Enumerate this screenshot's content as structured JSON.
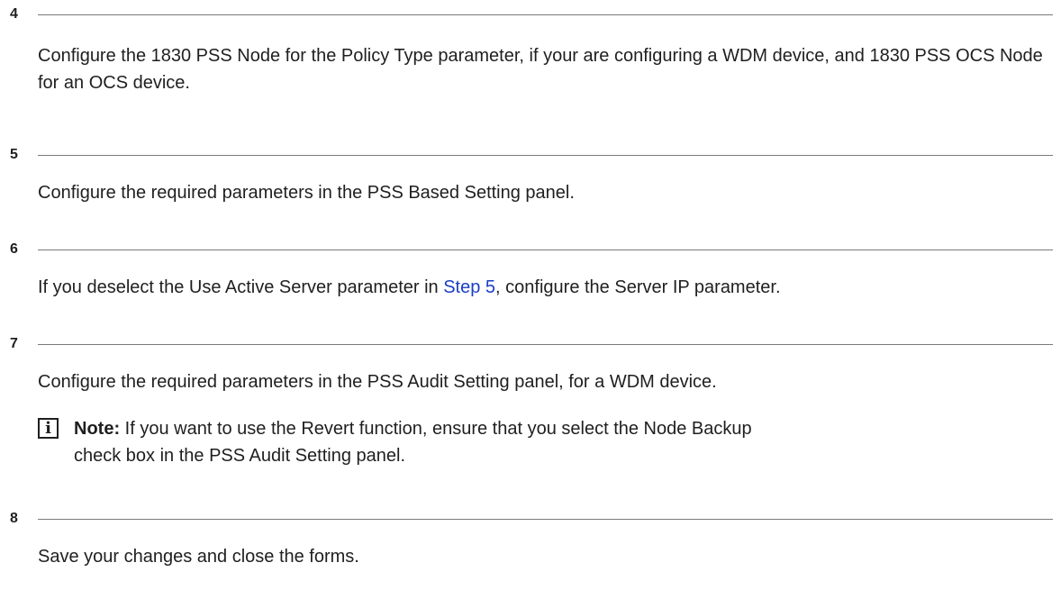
{
  "steps": [
    {
      "number": "4",
      "text": "Configure the 1830 PSS Node for the Policy Type parameter, if your are configuring a WDM device, and 1830 PSS OCS Node for an OCS device."
    },
    {
      "number": "5",
      "text": "Configure the required parameters in the PSS Based Setting panel."
    },
    {
      "number": "6",
      "text_before": "If you deselect the Use Active Server parameter in ",
      "link": "Step 5",
      "text_after": ", configure the Server IP parameter."
    },
    {
      "number": "7",
      "text": "Configure the required parameters in the PSS Audit Setting panel, for a WDM device.",
      "note": {
        "icon": "info-icon",
        "icon_glyph": "i",
        "label": "Note:",
        "text": " If you want to use the Revert function, ensure that you select the Node Backup check box in the PSS Audit Setting panel."
      }
    },
    {
      "number": "8",
      "text": "Save your changes and close the forms."
    }
  ],
  "colors": {
    "text": "#1f1f1f",
    "rule": "#7a7a7a",
    "link": "#1a3ec8"
  }
}
